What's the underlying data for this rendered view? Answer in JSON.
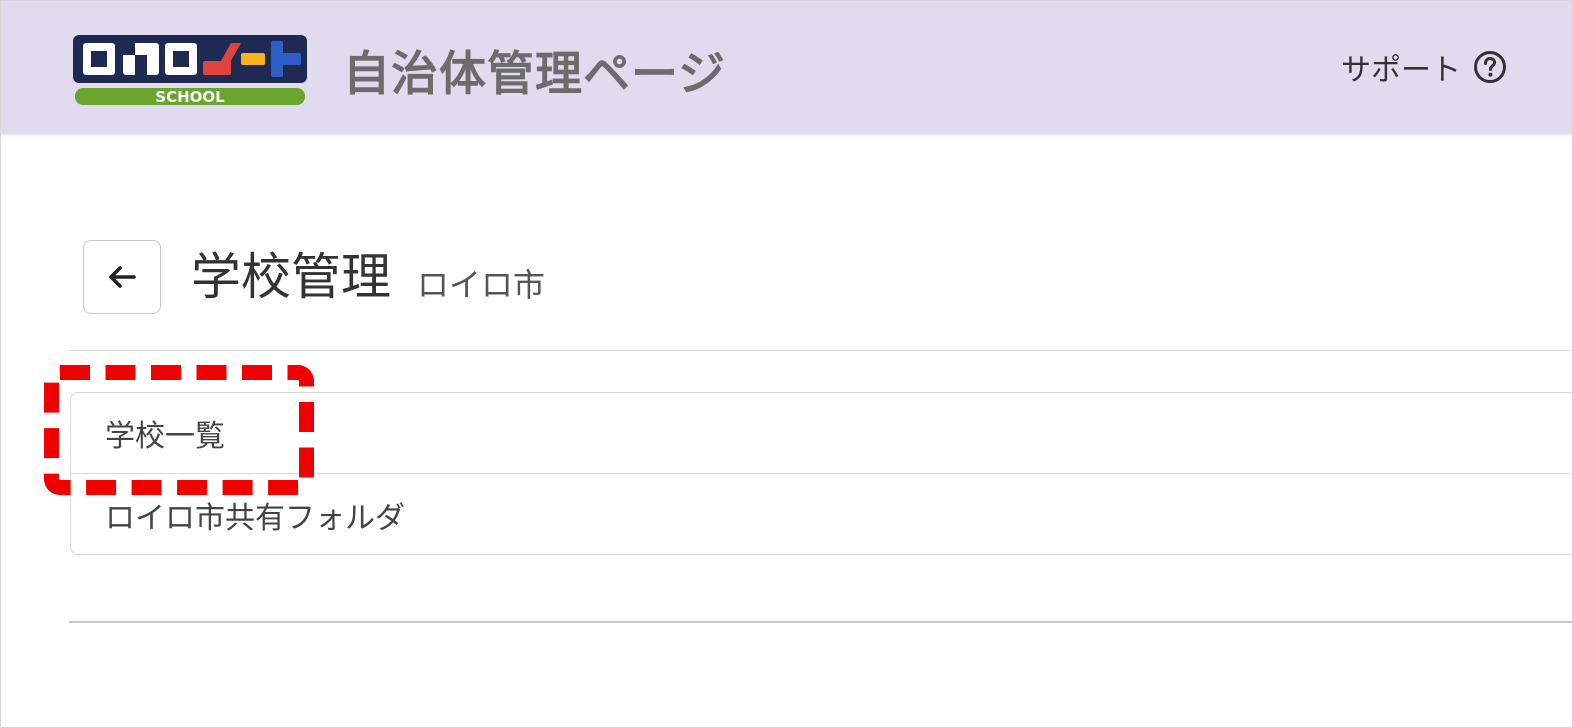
{
  "header": {
    "logo": {
      "main_text": "ロイロノート",
      "badge_text": "SCHOOL"
    },
    "app_title": "自治体管理ページ",
    "support_label": "サポート",
    "help_icon": "question-circle-icon",
    "background_color": "#e2daee"
  },
  "page": {
    "back_icon": "arrow-left-icon",
    "title": "学校管理",
    "subtitle": "ロイロ市"
  },
  "menu": {
    "items": [
      {
        "label": "学校一覧",
        "highlighted": true
      },
      {
        "label": "ロイロ市共有フォルダ",
        "highlighted": false
      }
    ]
  },
  "colors": {
    "highlight": "#f00000",
    "logo_navy": "#1e2a52",
    "logo_red": "#e0443a",
    "logo_yellow": "#f6b41a",
    "logo_blue": "#2e5fc9",
    "logo_green": "#6aa52e"
  }
}
